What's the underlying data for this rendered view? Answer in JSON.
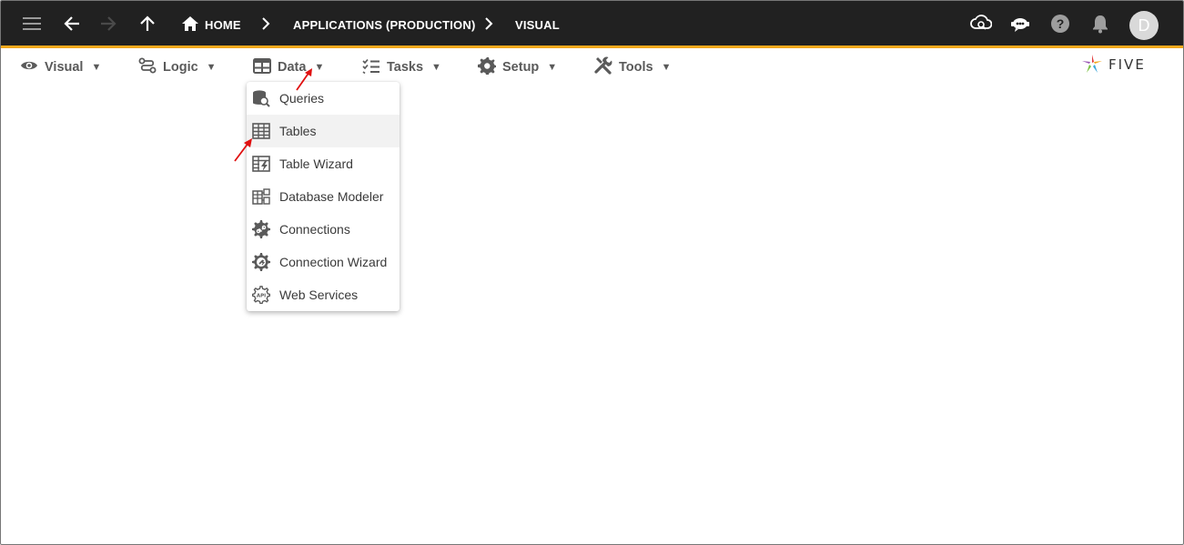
{
  "colors": {
    "appbar_bg": "#212121",
    "accent_line": "#f2a81c",
    "annotation_arrow": "#e01010"
  },
  "appbar": {
    "menu_icon": "hamburger-menu-icon",
    "back_icon": "arrow-left-icon",
    "forward_icon": "arrow-right-icon",
    "up_icon": "arrow-up-icon",
    "breadcrumb": {
      "home": "HOME",
      "applications": "APPLICATIONS (PRODUCTION)",
      "current": "VISUAL"
    },
    "right_icons": [
      "cloud-search-icon",
      "chatbot-icon",
      "help-icon",
      "bell-icon"
    ],
    "avatar_letter": "D"
  },
  "menubar": {
    "items": [
      {
        "label": "Visual",
        "icon": "eye-icon"
      },
      {
        "label": "Logic",
        "icon": "logic-flow-icon"
      },
      {
        "label": "Data",
        "icon": "table-icon"
      },
      {
        "label": "Tasks",
        "icon": "checklist-icon"
      },
      {
        "label": "Setup",
        "icon": "gear-icon"
      },
      {
        "label": "Tools",
        "icon": "tools-icon"
      }
    ],
    "caret": "▼"
  },
  "logo": {
    "text": "FIVE"
  },
  "data_dropdown": {
    "items": [
      {
        "label": "Queries",
        "icon": "database-search-icon"
      },
      {
        "label": "Tables",
        "icon": "grid-table-icon",
        "highlighted": true
      },
      {
        "label": "Table Wizard",
        "icon": "table-wizard-icon"
      },
      {
        "label": "Database Modeler",
        "icon": "database-modeler-icon"
      },
      {
        "label": "Connections",
        "icon": "connections-gear-icon"
      },
      {
        "label": "Connection Wizard",
        "icon": "connection-wizard-icon"
      },
      {
        "label": "Web Services",
        "icon": "api-gear-icon"
      }
    ]
  }
}
